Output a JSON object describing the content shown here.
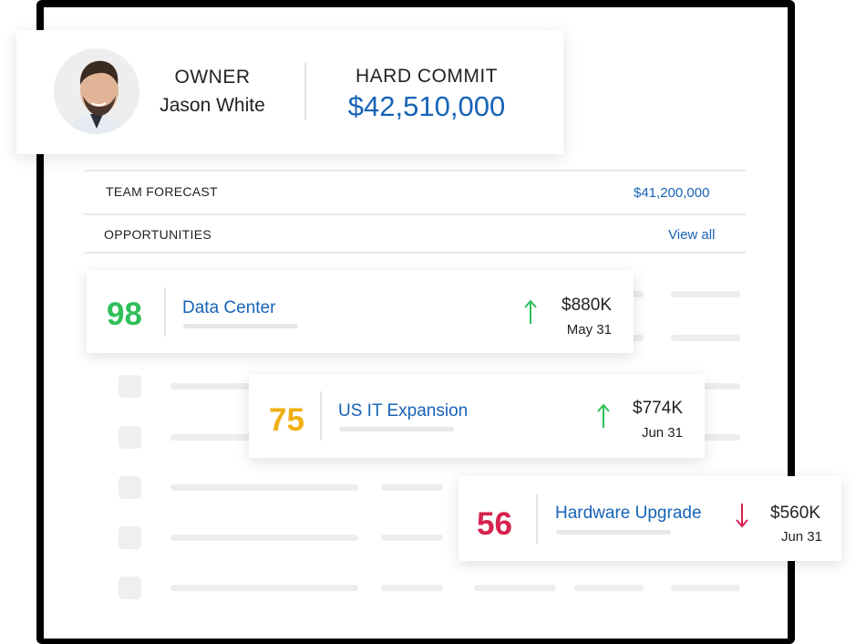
{
  "owner": {
    "label": "OWNER",
    "name": "Jason White"
  },
  "commit": {
    "label": "HARD COMMIT",
    "value": "$42,510,000"
  },
  "team_forecast": {
    "label": "TEAM FORECAST",
    "value": "$41,200,000"
  },
  "opportunities": {
    "label": "OPPORTUNITIES",
    "view_all": "View all",
    "items": [
      {
        "score": "98",
        "name": "Data Center",
        "amount": "$880K",
        "date": "May 31",
        "trend": "up",
        "score_color": "#2fbf5a",
        "arrow_color": "#2fbf5a"
      },
      {
        "score": "75",
        "name": "US IT Expansion",
        "amount": "$774K",
        "date": "Jun 31",
        "trend": "up",
        "score_color": "#f0b012",
        "arrow_color": "#2fbf5a"
      },
      {
        "score": "56",
        "name": "Hardware Upgrade",
        "amount": "$560K",
        "date": "Jun 31",
        "trend": "down",
        "score_color": "#d6224e",
        "arrow_color": "#d6224e"
      }
    ]
  },
  "colors": {
    "accent": "#1763b8",
    "frame": "#000000"
  },
  "icons": {
    "trend_up": "arrow-up-icon",
    "trend_down": "arrow-down-icon",
    "avatar": "user-avatar"
  }
}
